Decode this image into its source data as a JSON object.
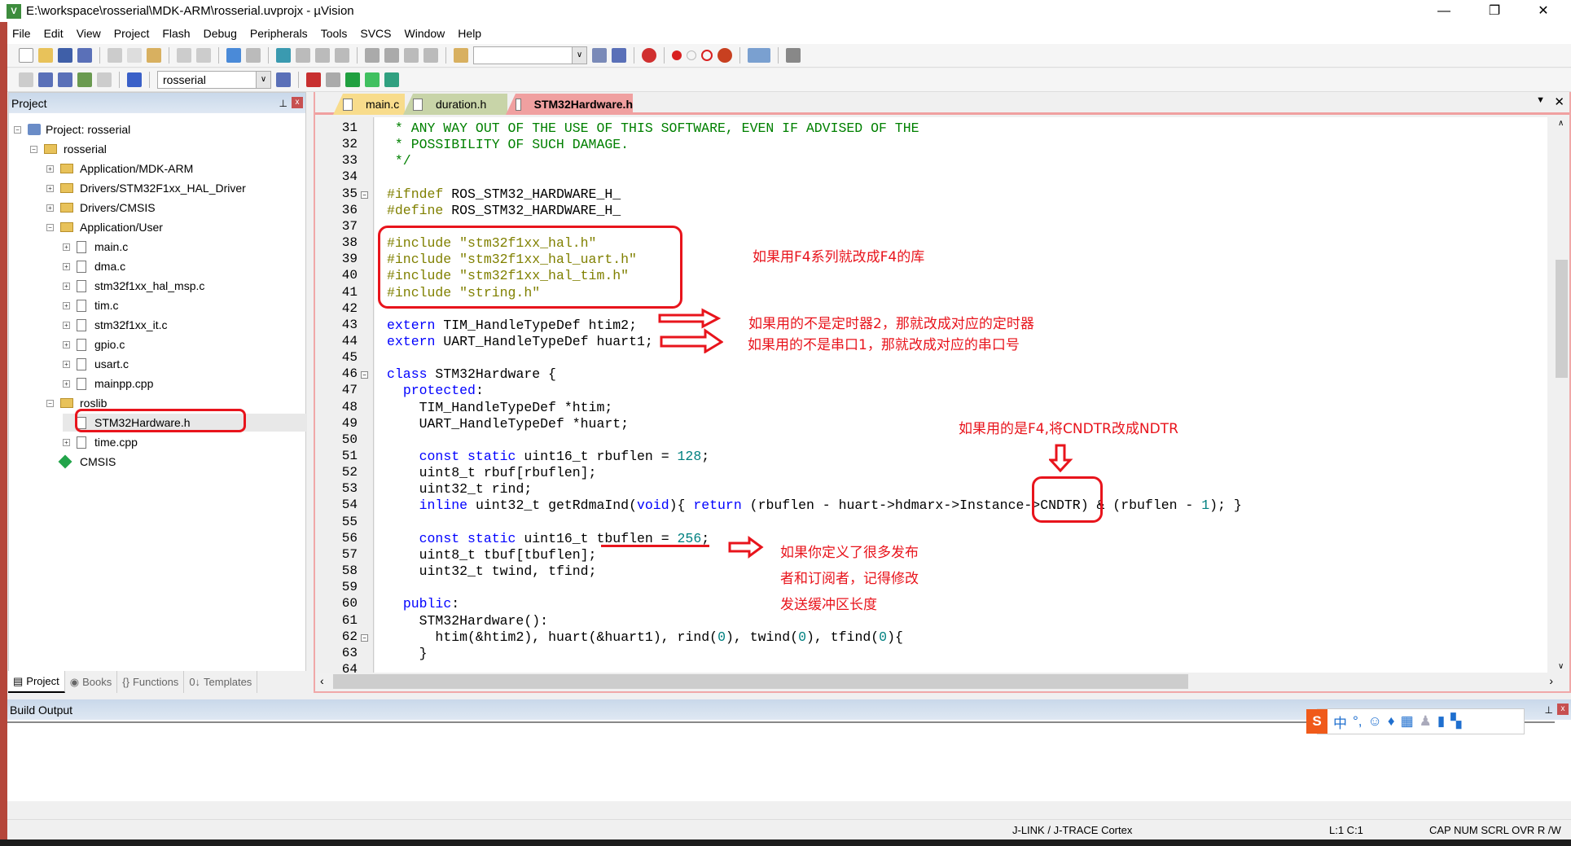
{
  "window": {
    "title": "E:\\workspace\\rosserial\\MDK-ARM\\rosserial.uvprojx - µVision",
    "minimize": "—",
    "restore": "❐",
    "close": "✕"
  },
  "menu": [
    "File",
    "Edit",
    "View",
    "Project",
    "Flash",
    "Debug",
    "Peripherals",
    "Tools",
    "SVCS",
    "Window",
    "Help"
  ],
  "toolbar2": {
    "target": "rosserial"
  },
  "project_panel": {
    "title": "Project",
    "tree": [
      {
        "label": "Project: rosserial",
        "depth": 0,
        "icon": "project",
        "exp": "−"
      },
      {
        "label": "rosserial",
        "depth": 1,
        "icon": "folder",
        "exp": "−"
      },
      {
        "label": "Application/MDK-ARM",
        "depth": 2,
        "icon": "folder",
        "exp": "+"
      },
      {
        "label": "Drivers/STM32F1xx_HAL_Driver",
        "depth": 2,
        "icon": "folder",
        "exp": "+"
      },
      {
        "label": "Drivers/CMSIS",
        "depth": 2,
        "icon": "folder",
        "exp": "+"
      },
      {
        "label": "Application/User",
        "depth": 2,
        "icon": "folder",
        "exp": "−"
      },
      {
        "label": "main.c",
        "depth": 3,
        "icon": "file",
        "exp": "+"
      },
      {
        "label": "dma.c",
        "depth": 3,
        "icon": "file",
        "exp": "+"
      },
      {
        "label": "stm32f1xx_hal_msp.c",
        "depth": 3,
        "icon": "file",
        "exp": "+"
      },
      {
        "label": "tim.c",
        "depth": 3,
        "icon": "file",
        "exp": "+"
      },
      {
        "label": "stm32f1xx_it.c",
        "depth": 3,
        "icon": "file",
        "exp": "+"
      },
      {
        "label": "gpio.c",
        "depth": 3,
        "icon": "file",
        "exp": "+"
      },
      {
        "label": "usart.c",
        "depth": 3,
        "icon": "file",
        "exp": "+"
      },
      {
        "label": "mainpp.cpp",
        "depth": 3,
        "icon": "file",
        "exp": "+"
      },
      {
        "label": "roslib",
        "depth": 2,
        "icon": "folder",
        "exp": "−"
      },
      {
        "label": "STM32Hardware.h",
        "depth": 3,
        "icon": "file",
        "exp": "",
        "selected": true
      },
      {
        "label": "time.cpp",
        "depth": 3,
        "icon": "file",
        "exp": "+"
      },
      {
        "label": "CMSIS",
        "depth": 2,
        "icon": "cmsis",
        "exp": ""
      }
    ],
    "tabs": [
      "Project",
      "Books",
      "Functions",
      "Templates"
    ]
  },
  "editor": {
    "tabs": [
      {
        "label": "main.c",
        "color": "#f8dc8c"
      },
      {
        "label": "duration.h",
        "color": "#c8d4a8"
      },
      {
        "label": "STM32Hardware.h",
        "color": "#f0a0a0",
        "active": true
      }
    ],
    "first_line": 31,
    "lines": [
      " * ANY WAY OUT OF THE USE OF THIS SOFTWARE, EVEN IF ADVISED OF THE",
      " * POSSIBILITY OF SUCH DAMAGE.",
      " */",
      "",
      "#ifndef ROS_STM32_HARDWARE_H_",
      "#define ROS_STM32_HARDWARE_H_",
      "",
      "#include \"stm32f1xx_hal.h\"",
      "#include \"stm32f1xx_hal_uart.h\"",
      "#include \"stm32f1xx_hal_tim.h\"",
      "#include \"string.h\"",
      "",
      "extern TIM_HandleTypeDef htim2;",
      "extern UART_HandleTypeDef huart1;",
      "",
      "class STM32Hardware {",
      "  protected:",
      "    TIM_HandleTypeDef *htim;",
      "    UART_HandleTypeDef *huart;",
      "",
      "    const static uint16_t rbuflen = 128;",
      "    uint8_t rbuf[rbuflen];",
      "    uint32_t rind;",
      "    inline uint32_t getRdmaInd(void){ return (rbuflen - huart->hdmarx->Instance->CNDTR) & (rbuflen - 1); }",
      "",
      "    const static uint16_t tbuflen = 256;",
      "    uint8_t tbuf[tbuflen];",
      "    uint32_t twind, tfind;",
      "",
      "  public:",
      "    STM32Hardware():",
      "      htim(&htim2), huart(&huart1), rind(0), twind(0), tfind(0){",
      "    }",
      ""
    ],
    "fold_lines": [
      35,
      46,
      62
    ]
  },
  "annotations": {
    "include_note": "如果用F4系列就改成F4的库",
    "timer_note": "如果用的不是定时器2，那就改成对应的定时器",
    "uart_note": "如果用的不是串口1，那就改成对应的串口号",
    "cndtr_note": "如果用的是F4,将CNDTR改成NDTR",
    "tbuf_note": [
      "如果你定义了很多发布",
      "者和订阅者，记得修改",
      "发送缓冲区长度"
    ],
    "color": "#e8141c"
  },
  "build_output": {
    "title": "Build Output"
  },
  "status": {
    "debugger": "J-LINK / J-TRACE Cortex",
    "position": "L:1 C:1",
    "flags": "CAP  NUM  SCRL  OVR  R /W"
  },
  "ime": {
    "lang": "中",
    "punct": "°,"
  }
}
